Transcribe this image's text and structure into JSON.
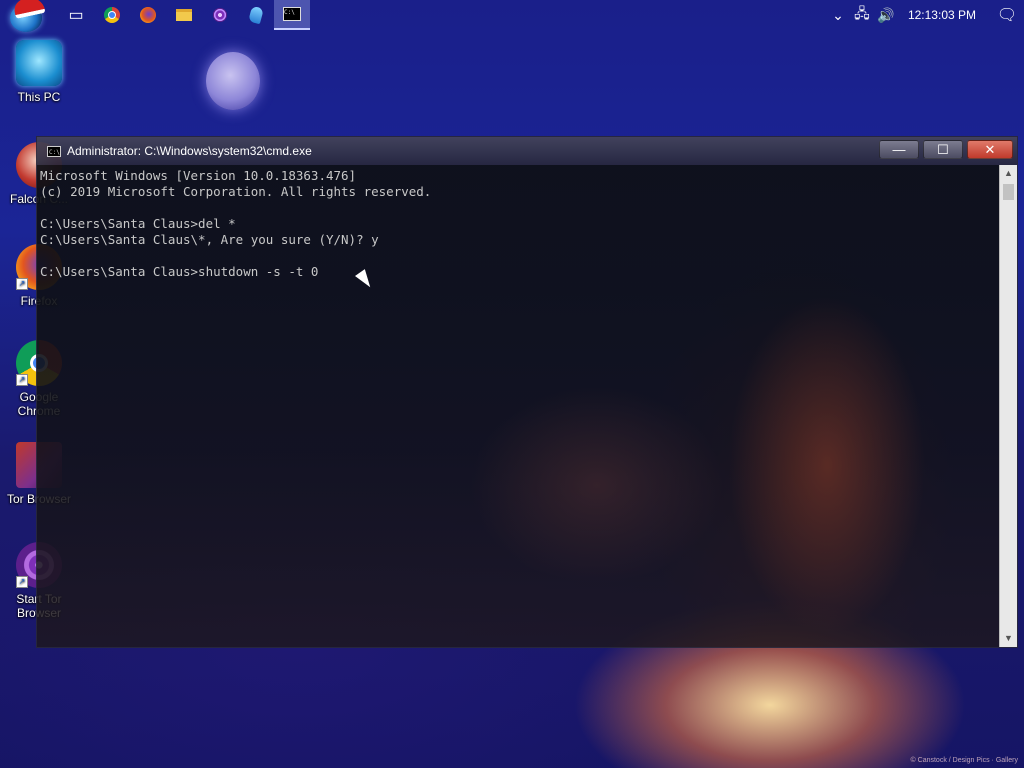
{
  "desktop": {
    "wallpaper_credit": "© Canstock / Design Pics · Gallery",
    "icons": [
      {
        "label": "This PC",
        "icon": "this-pc-icon"
      },
      {
        "label": "Falcon C...",
        "icon": "falcon-icon"
      },
      {
        "label": "Firefox",
        "icon": "firefox-icon"
      },
      {
        "label": "Google Chrome",
        "icon": "chrome-icon"
      },
      {
        "label": "Tor Browser",
        "icon": "tor-browser-icon"
      },
      {
        "label": "Start Tor Browser",
        "icon": "start-tor-browser-icon"
      }
    ]
  },
  "taskbar": {
    "start_icon": "start-orb-santa-hat-icon",
    "apps": [
      {
        "icon": "task-view-icon",
        "glyph": "▭"
      },
      {
        "icon": "chrome-icon",
        "glyph": "◉"
      },
      {
        "icon": "firefox-icon",
        "glyph": "◍"
      },
      {
        "icon": "file-explorer-icon",
        "glyph": "▰"
      },
      {
        "icon": "tor-icon",
        "glyph": "◎"
      },
      {
        "icon": "falcon-icon",
        "glyph": "◆"
      },
      {
        "icon": "cmd-icon",
        "glyph": "C:\\"
      }
    ],
    "tray": {
      "chevron_icon": "chevron-up-icon",
      "network_icon": "network-icon",
      "volume_icon": "volume-icon",
      "clock": "12:13:03 PM",
      "notification_icon": "action-center-icon"
    }
  },
  "cmd": {
    "title": "Administrator: C:\\Windows\\system32\\cmd.exe",
    "controls": {
      "minimize": "—",
      "maximize": "☐",
      "close": "✕"
    },
    "lines": "Microsoft Windows [Version 10.0.18363.476]\n(c) 2019 Microsoft Corporation. All rights reserved.\n\nC:\\Users\\Santa Claus>del *\nC:\\Users\\Santa Claus\\*, Are you sure (Y/N)? y\n\nC:\\Users\\Santa Claus>shutdown -s -t 0"
  }
}
